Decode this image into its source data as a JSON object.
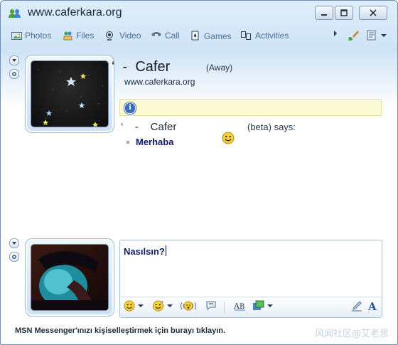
{
  "window": {
    "title": "www.caferkara.org"
  },
  "toolbar": {
    "items": [
      {
        "label": "Photos",
        "icon": "photos-icon"
      },
      {
        "label": "Files",
        "icon": "files-icon"
      },
      {
        "label": "Video",
        "icon": "video-icon"
      },
      {
        "label": "Call",
        "icon": "call-icon"
      },
      {
        "label": "Games",
        "icon": "games-icon"
      },
      {
        "label": "Activities",
        "icon": "activities-icon"
      }
    ]
  },
  "contact": {
    "name": "‘  -  Cafer",
    "status": "(Away)",
    "personal_message": "www.caferkara.org"
  },
  "conversation": {
    "sender": "‘    -    Cafer",
    "says": "(beta) says:",
    "message": "Merhaba"
  },
  "compose": {
    "text": "Nasılsın?"
  },
  "statusbar": {
    "text": "MSN Messenger'ınızı kişiselleştirmek için burayı tıklayın.",
    "watermark": "风闻社区@艾老思"
  },
  "colors": {
    "accent": "#3a6fb6",
    "message_text": "#0f1b66",
    "info_bar": "#fdfbd6"
  }
}
